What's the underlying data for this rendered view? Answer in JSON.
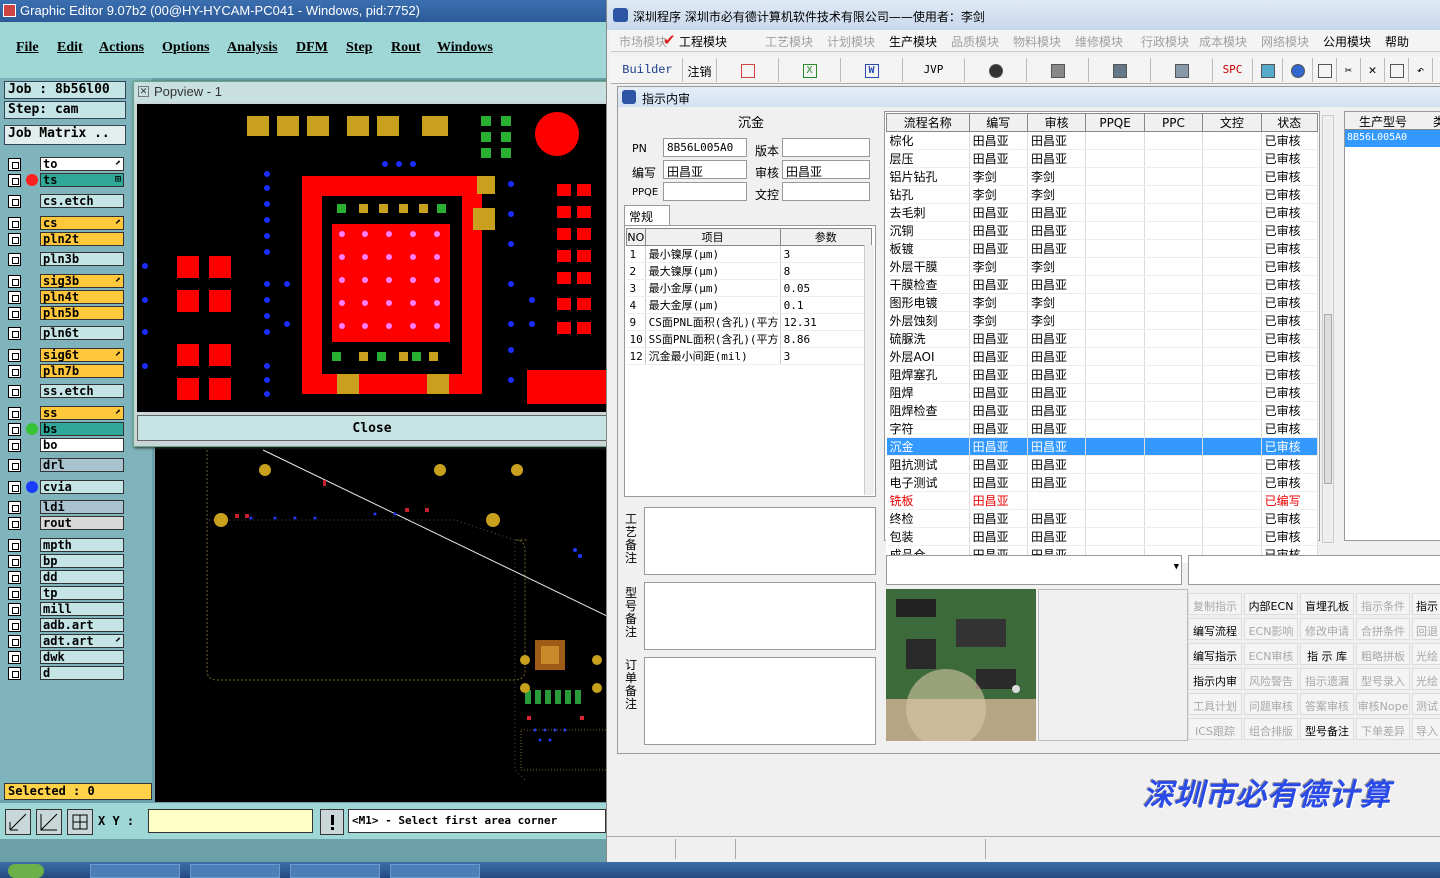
{
  "editor": {
    "title": "Graphic Editor 9.07b2 (00@HY-HYCAM-PC041 - Windows, pid:7752)",
    "menu": [
      "File",
      "Edit",
      "Actions",
      "Options",
      "Analysis",
      "DFM",
      "Step",
      "Rout",
      "Windows"
    ],
    "job": "Job : 8b56l00",
    "step": "Step: cam",
    "job_matrix": "Job Matrix ..",
    "layers": [
      {
        "name": "to",
        "color": "#ffffff",
        "marker": "⬈"
      },
      {
        "name": "ts",
        "color": "#2fa89a",
        "dot": "#ff2020",
        "marker": "⊞"
      },
      {
        "name": "cs.etch",
        "color": "#c5e4e6"
      },
      {
        "name": "cs",
        "color": "#ffc83c",
        "marker": "⬈"
      },
      {
        "name": "pln2t",
        "color": "#ffc83c"
      },
      {
        "name": "pln3b",
        "color": "#c5e4e6"
      },
      {
        "name": "sig3b",
        "color": "#ffc83c",
        "marker": "⬈"
      },
      {
        "name": "pln4t",
        "color": "#ffc83c"
      },
      {
        "name": "pln5b",
        "color": "#ffc83c"
      },
      {
        "name": "pln6t",
        "color": "#c5e4e6"
      },
      {
        "name": "sig6t",
        "color": "#ffc83c",
        "marker": "⬈"
      },
      {
        "name": "pln7b",
        "color": "#ffc83c"
      },
      {
        "name": "ss.etch",
        "color": "#c5e4e6"
      },
      {
        "name": "ss",
        "color": "#ffc83c",
        "marker": "⬈"
      },
      {
        "name": "bs",
        "color": "#2fa89a",
        "dot": "#34c434"
      },
      {
        "name": "bo",
        "color": "#ffffff"
      },
      {
        "name": "drl",
        "color": "#a9c4d0"
      },
      {
        "name": "cvia",
        "color": "#c5e4e6",
        "dot": "#1a3cff"
      },
      {
        "name": "ldi",
        "color": "#a9c4d0"
      },
      {
        "name": "rout",
        "color": "#d8d8d8"
      },
      {
        "name": "mpth",
        "color": "#c5e4e6"
      },
      {
        "name": "bp",
        "color": "#c5e4e6"
      },
      {
        "name": "dd",
        "color": "#c5e4e6"
      },
      {
        "name": "tp",
        "color": "#c5e4e6"
      },
      {
        "name": "mill",
        "color": "#c5e4e6"
      },
      {
        "name": "adb.art",
        "color": "#c5e4e6"
      },
      {
        "name": "adt.art",
        "color": "#c5e4e6",
        "marker": "⬈"
      },
      {
        "name": "dwk",
        "color": "#c5e4e6"
      },
      {
        "name": "d",
        "color": "#c5e4e6"
      }
    ],
    "selected": "Selected : 0",
    "xy_label": "X Y :",
    "xy_value": "",
    "message": "<M1> - Select first area corner",
    "popview_title": "Popview - 1",
    "close_label": "Close"
  },
  "app": {
    "title": "深圳程序     深圳市必有德计算机软件技术有限公司——使用者：李剑",
    "nav": [
      {
        "label": "市场模块",
        "enabled": false
      },
      {
        "label": "工程模块",
        "enabled": true,
        "checked": true
      },
      {
        "label": "工艺模块",
        "enabled": false
      },
      {
        "label": "计划模块",
        "enabled": false
      },
      {
        "label": "生产模块",
        "enabled": true
      },
      {
        "label": "品质模块",
        "enabled": false
      },
      {
        "label": "物料模块",
        "enabled": false
      },
      {
        "label": "维修模块",
        "enabled": false
      },
      {
        "label": "行政模块",
        "enabled": false
      },
      {
        "label": "成本模块",
        "enabled": false
      },
      {
        "label": "网络模块",
        "enabled": false
      },
      {
        "label": "公用模块",
        "enabled": true
      },
      {
        "label": "帮助",
        "enabled": true
      }
    ],
    "toolbar": {
      "builder": "Builder",
      "logout": "注销",
      "jvp": "JVP",
      "spc": "SPC"
    },
    "inner_title": "指示内审",
    "process_name": "沉金",
    "pn_label": "PN",
    "pn_value": "8B56L005A0",
    "version_label": "版本",
    "version_value": "",
    "writer_label": "编写",
    "writer_value": "田昌亚",
    "reviewer_label": "审核",
    "reviewer_value": "田昌亚",
    "ppqe_label": "PPQE",
    "ppqe_value": "",
    "doc_label": "文控",
    "doc_value": "",
    "tab_label": "常规",
    "params": {
      "headers": [
        "NO",
        "项目",
        "参数"
      ],
      "rows": [
        [
          "1",
          "最小镍厚(μm)",
          "3"
        ],
        [
          "2",
          "最大镍厚(μm)",
          "8"
        ],
        [
          "3",
          "最小金厚(μm)",
          "0.05"
        ],
        [
          "4",
          "最大金厚(μm)",
          "0.1"
        ],
        [
          "9",
          "CS面PNL面积(含孔)(平方",
          "12.31"
        ],
        [
          "10",
          "SS面PNL面积(含孔)(平方",
          "8.86"
        ],
        [
          "12",
          "沉金最小间距(mil)",
          "3"
        ]
      ]
    },
    "notes": [
      "工艺备注",
      "型号备注",
      "订单备注"
    ],
    "flow": {
      "headers": [
        "流程名称",
        "编写",
        "审核",
        "PPQE",
        "PPC",
        "文控",
        "状态"
      ],
      "rows": [
        [
          "棕化",
          "田昌亚",
          "田昌亚",
          "",
          "",
          "",
          "已审核"
        ],
        [
          "层压",
          "田昌亚",
          "田昌亚",
          "",
          "",
          "",
          "已审核"
        ],
        [
          "铝片钻孔",
          "李剑",
          "李剑",
          "",
          "",
          "",
          "已审核"
        ],
        [
          "钻孔",
          "李剑",
          "李剑",
          "",
          "",
          "",
          "已审核"
        ],
        [
          "去毛刺",
          "田昌亚",
          "田昌亚",
          "",
          "",
          "",
          "已审核"
        ],
        [
          "沉铜",
          "田昌亚",
          "田昌亚",
          "",
          "",
          "",
          "已审核"
        ],
        [
          "板镀",
          "田昌亚",
          "田昌亚",
          "",
          "",
          "",
          "已审核"
        ],
        [
          "外层干膜",
          "李剑",
          "李剑",
          "",
          "",
          "",
          "已审核"
        ],
        [
          "干膜检查",
          "田昌亚",
          "田昌亚",
          "",
          "",
          "",
          "已审核"
        ],
        [
          "图形电镀",
          "李剑",
          "李剑",
          "",
          "",
          "",
          "已审核"
        ],
        [
          "外层蚀刻",
          "李剑",
          "李剑",
          "",
          "",
          "",
          "已审核"
        ],
        [
          "硫脲洗",
          "田昌亚",
          "田昌亚",
          "",
          "",
          "",
          "已审核"
        ],
        [
          "外层AOI",
          "田昌亚",
          "田昌亚",
          "",
          "",
          "",
          "已审核"
        ],
        [
          "阻焊塞孔",
          "田昌亚",
          "田昌亚",
          "",
          "",
          "",
          "已审核"
        ],
        [
          "阻焊",
          "田昌亚",
          "田昌亚",
          "",
          "",
          "",
          "已审核"
        ],
        [
          "阻焊检查",
          "田昌亚",
          "田昌亚",
          "",
          "",
          "",
          "已审核"
        ],
        [
          "字符",
          "田昌亚",
          "田昌亚",
          "",
          "",
          "",
          "已审核"
        ],
        [
          "沉金",
          "田昌亚",
          "田昌亚",
          "",
          "",
          "",
          "已审核"
        ],
        [
          "阻抗测试",
          "田昌亚",
          "田昌亚",
          "",
          "",
          "",
          "已审核"
        ],
        [
          "电子测试",
          "田昌亚",
          "田昌亚",
          "",
          "",
          "",
          "已审核"
        ],
        [
          "铣板",
          "田昌亚",
          "",
          "",
          "",
          "",
          "已编写"
        ],
        [
          "终检",
          "田昌亚",
          "田昌亚",
          "",
          "",
          "",
          "已审核"
        ],
        [
          "包装",
          "田昌亚",
          "田昌亚",
          "",
          "",
          "",
          "已审核"
        ],
        [
          "成品仓",
          "田昌亚",
          "田昌亚",
          "",
          "",
          "",
          "已审核"
        ]
      ],
      "selected_index": 17,
      "red_index": 20
    },
    "model_header": "生产型号",
    "model_header2": "类",
    "model_value": "8B56L005A0",
    "buttons": [
      [
        "复制指示",
        "内部ECN",
        "盲埋孔板",
        "指示条件",
        "指示"
      ],
      [
        "编写流程",
        "ECN影响",
        "修改申请",
        "合拼条件",
        "回退"
      ],
      [
        "编写指示",
        "ECN审核",
        "指 示 库",
        "粗略拼板",
        "光绘"
      ],
      [
        "指示内审",
        "风险警告",
        "指示遗漏",
        "型号录入",
        "光绘"
      ],
      [
        "工具计划",
        "问题审核",
        "答案审核",
        "审核Nope",
        "测试"
      ],
      [
        "ICS跟踪",
        "组合排版",
        "型号备注",
        "下单差异",
        "导入"
      ]
    ],
    "buttons_enabled": [
      [
        false,
        true,
        true,
        false,
        true
      ],
      [
        true,
        false,
        false,
        false,
        false
      ],
      [
        true,
        false,
        true,
        false,
        false
      ],
      [
        true,
        false,
        false,
        false,
        false
      ],
      [
        false,
        false,
        false,
        false,
        false
      ],
      [
        false,
        false,
        true,
        false,
        false
      ]
    ],
    "banner": "深圳市必有德计算"
  }
}
